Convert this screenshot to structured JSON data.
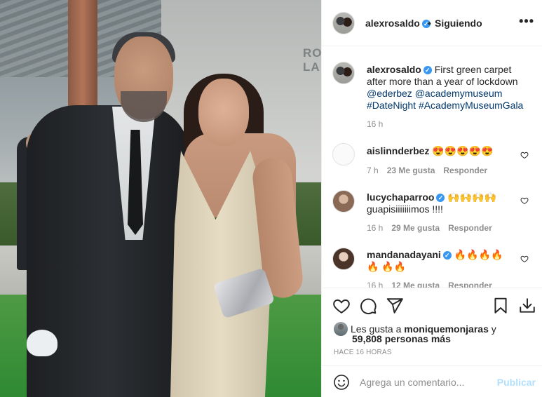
{
  "photo": {
    "sign_text": "RO\nLA"
  },
  "header": {
    "username": "alexrosaldo",
    "verified_mark": "✓",
    "separator": "•",
    "follow_status": "Siguiendo",
    "more_label": "•••"
  },
  "caption": {
    "username": "alexrosaldo",
    "text": "First green carpet after more than a year of lockdown",
    "mentions": [
      "@ederbez",
      "@academymuseum"
    ],
    "hashtags": [
      "#DateNight",
      "#AcademyMuseumGala"
    ],
    "time": "16 h"
  },
  "comments": [
    {
      "username": "aislinnderbez",
      "verified": false,
      "text": "😍😍😍😍😍",
      "time": "7 h",
      "likes": "23 Me gusta",
      "reply": "Responder"
    },
    {
      "username": "lucychaparroo",
      "verified": true,
      "text": "🙌🙌🙌🙌 guapisiiiiiiimos !!!!",
      "time": "16 h",
      "likes": "29 Me gusta",
      "reply": "Responder"
    },
    {
      "username": "mandanadayani",
      "verified": true,
      "text": "🔥🔥🔥🔥🔥 🔥🔥",
      "time": "16 h",
      "likes": "12 Me gusta",
      "reply": "Responder"
    }
  ],
  "likes": {
    "prefix": "Les gusta a",
    "user": "moniquemonjaras",
    "connector": "y",
    "count": "59,808 personas más"
  },
  "timestamp": "Hace 16 horas",
  "add_comment": {
    "placeholder": "Agrega un comentario...",
    "post_label": "Publicar"
  },
  "colors": {
    "verified": "#3897f0",
    "link": "#00376b",
    "muted": "#8e8e8e",
    "post_disabled": "#b2dffc"
  }
}
